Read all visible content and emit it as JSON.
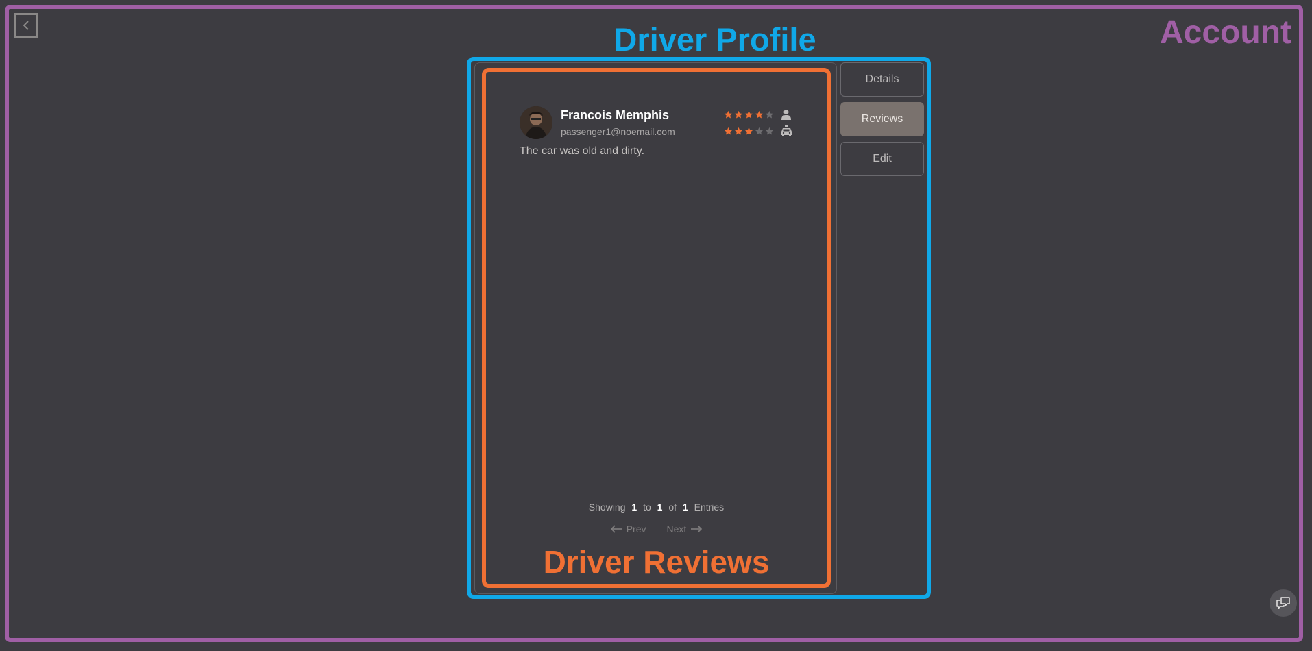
{
  "annotations": {
    "account_label": "Account",
    "profile_label": "Driver Profile",
    "reviews_label": "Driver Reviews"
  },
  "tabs": [
    {
      "label": "Details",
      "active": false
    },
    {
      "label": "Reviews",
      "active": true
    },
    {
      "label": "Edit",
      "active": false
    }
  ],
  "review": {
    "name": "Francois Memphis",
    "email": "passenger1@noemail.com",
    "passenger_rating": 4,
    "driver_rating": 3,
    "max_rating": 5,
    "text": "The car was old and dirty."
  },
  "pager": {
    "showing_label": "Showing",
    "from": "1",
    "to_label": "to",
    "to": "1",
    "of_label": "of",
    "total": "1",
    "entries_label": "Entries",
    "prev_label": "Prev",
    "next_label": "Next"
  },
  "colors": {
    "star_filled": "#f07034",
    "star_empty": "#6e6d70",
    "account_accent": "#a05fa5",
    "profile_accent": "#10a8e8",
    "reviews_accent": "#f07034"
  },
  "icons": {
    "back": "chevron-left-icon",
    "passenger": "user-icon",
    "driver": "taxi-icon",
    "chat": "chat-icon",
    "prev": "arrow-left-icon",
    "next": "arrow-right-icon"
  }
}
